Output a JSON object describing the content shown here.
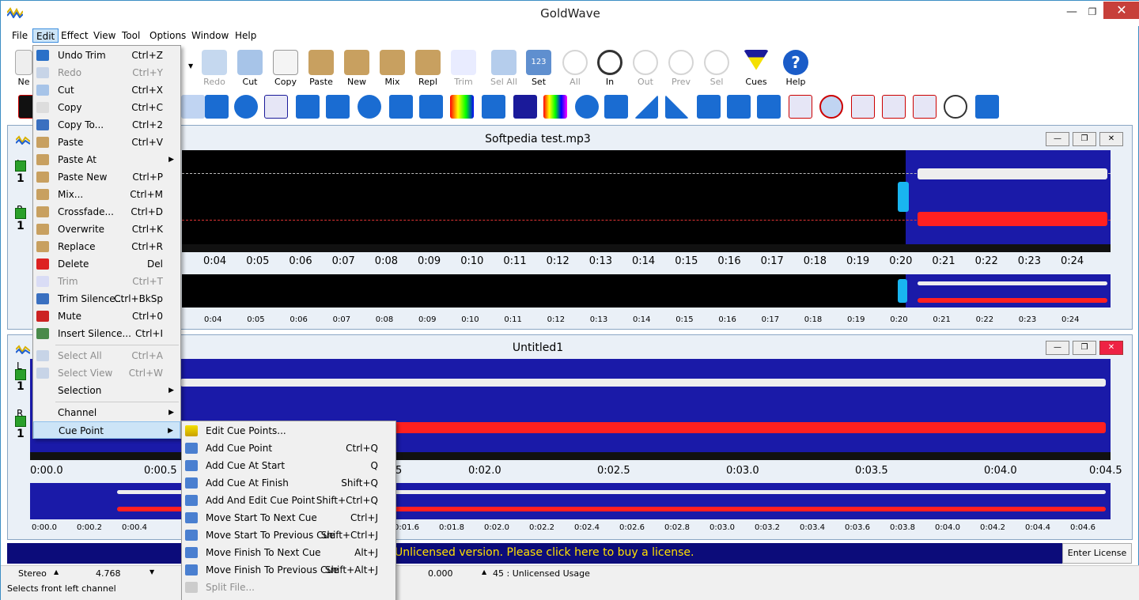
{
  "app": {
    "title": "GoldWave"
  },
  "menubar": [
    "File",
    "Edit",
    "Effect",
    "View",
    "Tool",
    "Options",
    "Window",
    "Help"
  ],
  "toolbar": [
    {
      "label": "Redo",
      "enabled": false
    },
    {
      "label": "Cut",
      "enabled": true
    },
    {
      "label": "Copy",
      "enabled": true
    },
    {
      "label": "Paste",
      "enabled": true
    },
    {
      "label": "New",
      "enabled": true
    },
    {
      "label": "Mix",
      "enabled": true
    },
    {
      "label": "Repl",
      "enabled": true
    },
    {
      "label": "Trim",
      "enabled": false
    },
    {
      "label": "Sel All",
      "enabled": false
    },
    {
      "label": "Set",
      "enabled": true
    },
    {
      "label": "All",
      "enabled": false
    },
    {
      "label": "In",
      "enabled": true
    },
    {
      "label": "Out",
      "enabled": false
    },
    {
      "label": "Prev",
      "enabled": false
    },
    {
      "label": "Sel",
      "enabled": false
    },
    {
      "label": "Cues",
      "enabled": true
    },
    {
      "label": "Help",
      "enabled": true
    }
  ],
  "toolbar_partial_label": "Ne",
  "edit_menu": [
    {
      "label": "Undo Trim",
      "shortcut": "Ctrl+Z",
      "enabled": true
    },
    {
      "label": "Redo",
      "shortcut": "Ctrl+Y",
      "enabled": false
    },
    {
      "label": "Cut",
      "shortcut": "Ctrl+X",
      "enabled": true
    },
    {
      "label": "Copy",
      "shortcut": "Ctrl+C",
      "enabled": true
    },
    {
      "label": "Copy To...",
      "shortcut": "Ctrl+2",
      "enabled": true
    },
    {
      "label": "Paste",
      "shortcut": "Ctrl+V",
      "enabled": true
    },
    {
      "label": "Paste At",
      "shortcut": "",
      "enabled": true,
      "submenu": true
    },
    {
      "label": "Paste New",
      "shortcut": "Ctrl+P",
      "enabled": true
    },
    {
      "label": "Mix...",
      "shortcut": "Ctrl+M",
      "enabled": true
    },
    {
      "label": "Crossfade...",
      "shortcut": "Ctrl+D",
      "enabled": true
    },
    {
      "label": "Overwrite",
      "shortcut": "Ctrl+K",
      "enabled": true
    },
    {
      "label": "Replace",
      "shortcut": "Ctrl+R",
      "enabled": true
    },
    {
      "label": "Delete",
      "shortcut": "Del",
      "enabled": true
    },
    {
      "label": "Trim",
      "shortcut": "Ctrl+T",
      "enabled": false
    },
    {
      "label": "Trim Silence...",
      "shortcut": "Ctrl+BkSp",
      "enabled": true
    },
    {
      "label": "Mute",
      "shortcut": "Ctrl+0",
      "enabled": true
    },
    {
      "label": "Insert Silence...",
      "shortcut": "Ctrl+I",
      "enabled": true
    },
    {
      "label": "Select All",
      "shortcut": "Ctrl+A",
      "enabled": false
    },
    {
      "label": "Select View",
      "shortcut": "Ctrl+W",
      "enabled": false
    },
    {
      "label": "Selection",
      "shortcut": "",
      "enabled": true,
      "submenu": true
    },
    {
      "label": "Channel",
      "shortcut": "",
      "enabled": true,
      "submenu": true
    },
    {
      "label": "Cue Point",
      "shortcut": "",
      "enabled": true,
      "submenu": true
    }
  ],
  "cue_menu": [
    {
      "label": "Edit Cue Points...",
      "shortcut": "",
      "enabled": true
    },
    {
      "label": "Add Cue Point",
      "shortcut": "Ctrl+Q",
      "enabled": true
    },
    {
      "label": "Add Cue At Start",
      "shortcut": "Q",
      "enabled": true
    },
    {
      "label": "Add Cue At Finish",
      "shortcut": "Shift+Q",
      "enabled": true
    },
    {
      "label": "Add And Edit Cue Point",
      "shortcut": "Shift+Ctrl+Q",
      "enabled": true
    },
    {
      "label": "Move Start To Next Cue",
      "shortcut": "Ctrl+J",
      "enabled": true
    },
    {
      "label": "Move Start To Previous Cue",
      "shortcut": "Shift+Ctrl+J",
      "enabled": true
    },
    {
      "label": "Move Finish To Next Cue",
      "shortcut": "Alt+J",
      "enabled": true
    },
    {
      "label": "Move Finish To Previous Cue",
      "shortcut": "Shift+Alt+J",
      "enabled": true
    },
    {
      "label": "Split File...",
      "shortcut": "",
      "enabled": false
    }
  ],
  "doc1": {
    "title": "Softpedia test.mp3",
    "ticks": [
      "0:04",
      "0:05",
      "0:06",
      "0:07",
      "0:08",
      "0:09",
      "0:10",
      "0:11",
      "0:12",
      "0:13",
      "0:14",
      "0:15",
      "0:16",
      "0:17",
      "0:18",
      "0:19",
      "0:20",
      "0:21",
      "0:22",
      "0:23",
      "0:24"
    ],
    "overview_ticks": [
      "0:04",
      "0:05",
      "0:06",
      "0:07",
      "0:08",
      "0:09",
      "0:10",
      "0:11",
      "0:12",
      "0:13",
      "0:14",
      "0:15",
      "0:16",
      "0:17",
      "0:18",
      "0:19",
      "0:20",
      "0:21",
      "0:22",
      "0:23",
      "0:24"
    ]
  },
  "doc2": {
    "title": "Untitled1",
    "ticks": [
      "0:00.0",
      "0:00.5",
      "",
      "",
      "0:02.0",
      "0:02.5",
      "0:03.0",
      "0:03.5",
      "0:04.0",
      "0:04.5"
    ],
    "ticks_visible_5": "5",
    "overview_ticks": [
      "0:00.0",
      "0:00.2",
      "0:00.4",
      "0:01.6",
      "0:01.8",
      "0:02.0",
      "0:02.2",
      "0:02.4",
      "0:02.6",
      "0:02.8",
      "0:03.0",
      "0:03.2",
      "0:03.4",
      "0:03.6",
      "0:03.8",
      "0:04.0",
      "0:04.2",
      "0:04.4",
      "0:04.6"
    ]
  },
  "channels": {
    "left": "L",
    "right": "R",
    "one": "1"
  },
  "license": {
    "message": "Unlicensed version. Please click here to buy a license.",
    "button": "Enter License"
  },
  "status": {
    "channels": "Stereo",
    "length": "4.768",
    "position": "0.000",
    "usage": "45 : Unlicensed Usage",
    "hint": "Selects front left channel"
  },
  "colors": {
    "selection": "#1a1aa8",
    "left_wave": "#ffffff",
    "right_wave": "#ff2020",
    "cue_marker": "#19b5f0",
    "license_text": "#ffe000"
  }
}
